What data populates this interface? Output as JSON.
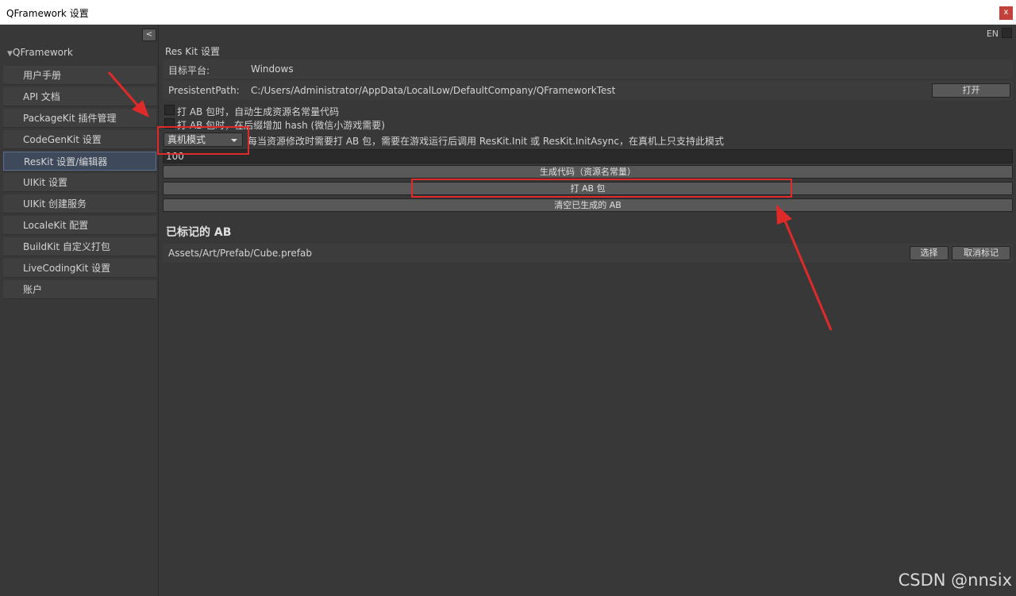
{
  "window": {
    "title": "QFramework 设置",
    "close_label": "x"
  },
  "sidebar": {
    "collapse_label": "<",
    "root_label": "QFramework",
    "items": [
      {
        "label": "用户手册"
      },
      {
        "label": "API 文档"
      },
      {
        "label": "PackageKit 插件管理"
      },
      {
        "label": "CodeGenKit 设置"
      },
      {
        "label": "ResKit 设置/编辑器"
      },
      {
        "label": "UIKit 设置"
      },
      {
        "label": "UIKit 创建服务"
      },
      {
        "label": "LocaleKit 配置"
      },
      {
        "label": "BuildKit 自定义打包"
      },
      {
        "label": "LiveCodingKit 设置"
      },
      {
        "label": "账户"
      }
    ]
  },
  "main": {
    "lang_label": "EN",
    "section_title": "Res Kit 设置",
    "platform_label": "目标平台:",
    "platform_value": "Windows",
    "path_label": "PresistentPath:",
    "path_value": "C:/Users/Administrator/AppData/LocalLow/DefaultCompany/QFrameworkTest",
    "open_button": "打开",
    "checkbox1_label": "打 AB 包时，自动生成资源名常量代码",
    "checkbox2_label": "打 AB 包时，在后缀增加 hash (微信小游戏需要)",
    "mode_selected": "真机模式",
    "mode_description": "每当资源修改时需要打 AB 包，需要在游戏运行后调用 ResKit.Init 或 ResKit.InitAsync，在真机上只支持此模式",
    "text_field_value": "100",
    "gen_code_button": "生成代码（资源名常量）",
    "build_ab_button": "打 AB 包",
    "clear_ab_button": "清空已生成的 AB",
    "marked_title": "已标记的 AB",
    "marked_items": [
      {
        "path": "Assets/Art/Prefab/Cube.prefab",
        "select_button": "选择",
        "unmark_button": "取消标记"
      }
    ]
  },
  "watermark": "CSDN @nnsix",
  "colors": {
    "annotation": "#e02a2a",
    "selected_nav": "#3e4a5c"
  }
}
